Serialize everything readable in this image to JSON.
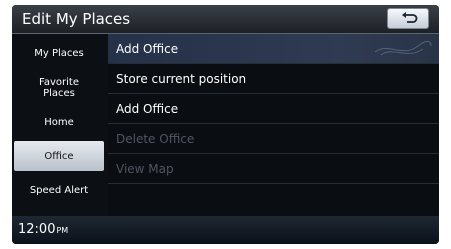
{
  "header": {
    "title": "Edit My Places",
    "back_icon": "back-arrow-icon"
  },
  "sidebar": {
    "items": [
      {
        "label": "My Places"
      },
      {
        "label": "Favorite Places"
      },
      {
        "label": "Home"
      },
      {
        "label": "Office",
        "selected": true
      },
      {
        "label": "Speed Alert"
      }
    ]
  },
  "content": {
    "section_title": "Add Office",
    "options": [
      {
        "label": "Store current position",
        "enabled": true
      },
      {
        "label": "Add Office",
        "enabled": true
      },
      {
        "label": "Delete Office",
        "enabled": false
      },
      {
        "label": "View Map",
        "enabled": false
      }
    ]
  },
  "status_bar": {
    "time": "12:00",
    "ampm": "PM"
  }
}
